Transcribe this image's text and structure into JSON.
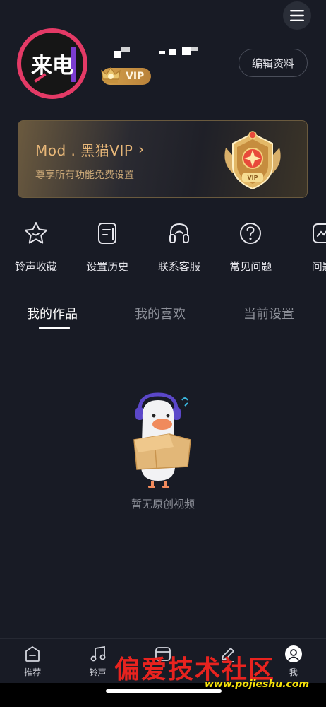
{
  "header": {
    "avatar_text": "来电",
    "vip_label": "VIP",
    "edit_label": "编辑资料"
  },
  "vip_card": {
    "title": "Mod . 黑猫VIP",
    "arrow": "›",
    "subtitle": "尊享所有功能免费设置",
    "medal_text": "VIP"
  },
  "quick_actions": [
    {
      "label": "铃声收藏",
      "icon": "star-icon"
    },
    {
      "label": "设置历史",
      "icon": "history-icon"
    },
    {
      "label": "联系客服",
      "icon": "headset-icon"
    },
    {
      "label": "常见问题",
      "icon": "question-icon"
    },
    {
      "label": "问题",
      "icon": "feedback-icon"
    }
  ],
  "tabs": [
    {
      "label": "我的作品",
      "active": true
    },
    {
      "label": "我的喜欢",
      "active": false
    },
    {
      "label": "当前设置",
      "active": false
    }
  ],
  "empty_state": {
    "text": "暂无原创视频"
  },
  "bottom_nav": [
    {
      "label": "推荐",
      "icon": "home-icon"
    },
    {
      "label": "铃声",
      "icon": "music-icon"
    },
    {
      "label": "",
      "icon": "video-icon"
    },
    {
      "label": "",
      "icon": "edit-icon"
    },
    {
      "label": "我",
      "icon": "profile-icon"
    }
  ],
  "watermark": {
    "text": "偏爱技术社区",
    "url": "www.pojieshu.com"
  },
  "colors": {
    "background": "#181b25",
    "accent_gold": "#e9b879",
    "avatar_ring": "#e43a66"
  }
}
